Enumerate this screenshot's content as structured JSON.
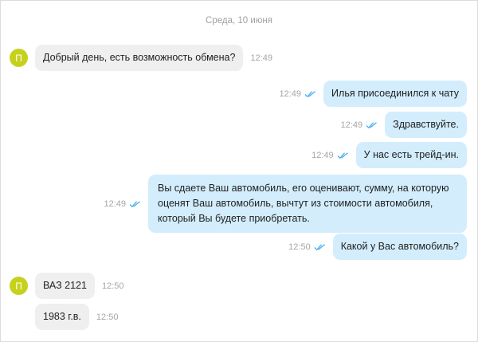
{
  "date_separator": "Среда, 10 июня",
  "avatar_letter": "П",
  "colors": {
    "incoming_bubble": "#efefef",
    "outgoing_bubble": "#d3edfc",
    "avatar": "#c5d11c",
    "read_ticks": "#4aaef0"
  },
  "messages": [
    {
      "direction": "incoming",
      "text": "Добрый день, есть возможность обмена?",
      "time": "12:49",
      "avatar": true
    },
    {
      "direction": "outgoing",
      "text": "Илья присоединился к чату",
      "time": "12:49",
      "status_icon": "double-check-icon"
    },
    {
      "direction": "outgoing",
      "text": "Здравствуйте.",
      "time": "12:49",
      "status_icon": "double-check-icon"
    },
    {
      "direction": "outgoing",
      "text": "У нас есть трейд-ин.",
      "time": "12:49",
      "status_icon": "double-check-icon"
    },
    {
      "direction": "outgoing",
      "text": "Вы сдаете Ваш автомобиль, его оценивают, сумму, на которую оценят Ваш автомобиль, вычтут из стоимости автомобиля, который Вы будете приобретать.",
      "time": "12:49",
      "status_icon": "double-check-icon"
    },
    {
      "direction": "outgoing",
      "text": "Какой у Вас автомобиль?",
      "time": "12:50",
      "status_icon": "double-check-icon"
    },
    {
      "direction": "incoming",
      "text": "ВАЗ 2121",
      "time": "12:50",
      "avatar": true
    },
    {
      "direction": "incoming",
      "text": "1983 г.в.",
      "time": "12:50",
      "avatar": false
    }
  ]
}
